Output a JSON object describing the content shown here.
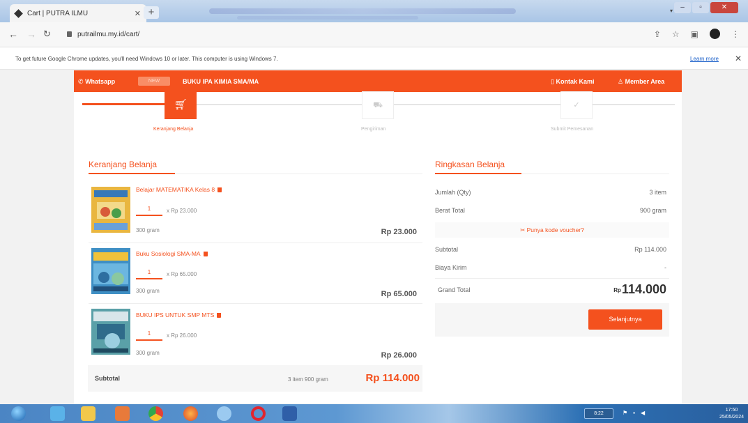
{
  "browser": {
    "tab_title": "Cart | PUTRA ILMU",
    "url": "putrailmu.my.id/cart/",
    "infobar_message": "To get future Google Chrome updates, you'll need Windows 10 or later. This computer is using Windows 7.",
    "learn_more": "Learn more"
  },
  "topbar": {
    "whatsapp": "Whatsapp",
    "badge": "NEW",
    "promo": "BUKU IPA KIMIA SMA/MA",
    "contact": "Kontak Kami",
    "member": "Member Area"
  },
  "steps": [
    {
      "label": "Keranjang Belanja",
      "active": true
    },
    {
      "label": "Pengiriman",
      "active": false
    },
    {
      "label": "Submit Pemesanan",
      "active": false
    }
  ],
  "cart": {
    "heading": "Keranjang Belanja",
    "items": [
      {
        "title": "Belajar MATEMATIKA Kelas 8",
        "qty": "1",
        "unit_price": "x Rp 23.000",
        "weight": "300 gram",
        "price": "Rp 23.000",
        "cover_color": "#e9b640"
      },
      {
        "title": "Buku Sosiologi SMA-MA",
        "qty": "1",
        "unit_price": "x Rp 65.000",
        "weight": "300 gram",
        "price": "Rp 65.000",
        "cover_color": "#3f8fc4"
      },
      {
        "title": "BUKU IPS UNTUK SMP MTS",
        "qty": "1",
        "unit_price": "x Rp 26.000",
        "weight": "300 gram",
        "price": "Rp 26.000",
        "cover_color": "#5aa0a8"
      }
    ],
    "subtotal_label": "Subtotal",
    "subtotal_count": "3 item 900 gram",
    "subtotal_value": "Rp 114.000"
  },
  "summary": {
    "heading": "Ringkasan Belanja",
    "qty_label": "Jumlah (Qty)",
    "qty_value": "3 item",
    "weight_label": "Berat Total",
    "weight_value": "900 gram",
    "voucher": "Punya kode voucher?",
    "subtotal_label": "Subtotal",
    "subtotal_value": "Rp 114.000",
    "shipping_label": "Biaya Kirim",
    "shipping_value": "-",
    "grand_label": "Grand Total",
    "grand_currency": "Rp",
    "grand_value": "114.000",
    "next_button": "Selanjutnya"
  },
  "taskbar": {
    "time": "17:50",
    "date": "25/05/2024",
    "tray_label": "8:22"
  },
  "colors": {
    "brand": "#f4511e",
    "taskbar": "#3b7cc0"
  }
}
